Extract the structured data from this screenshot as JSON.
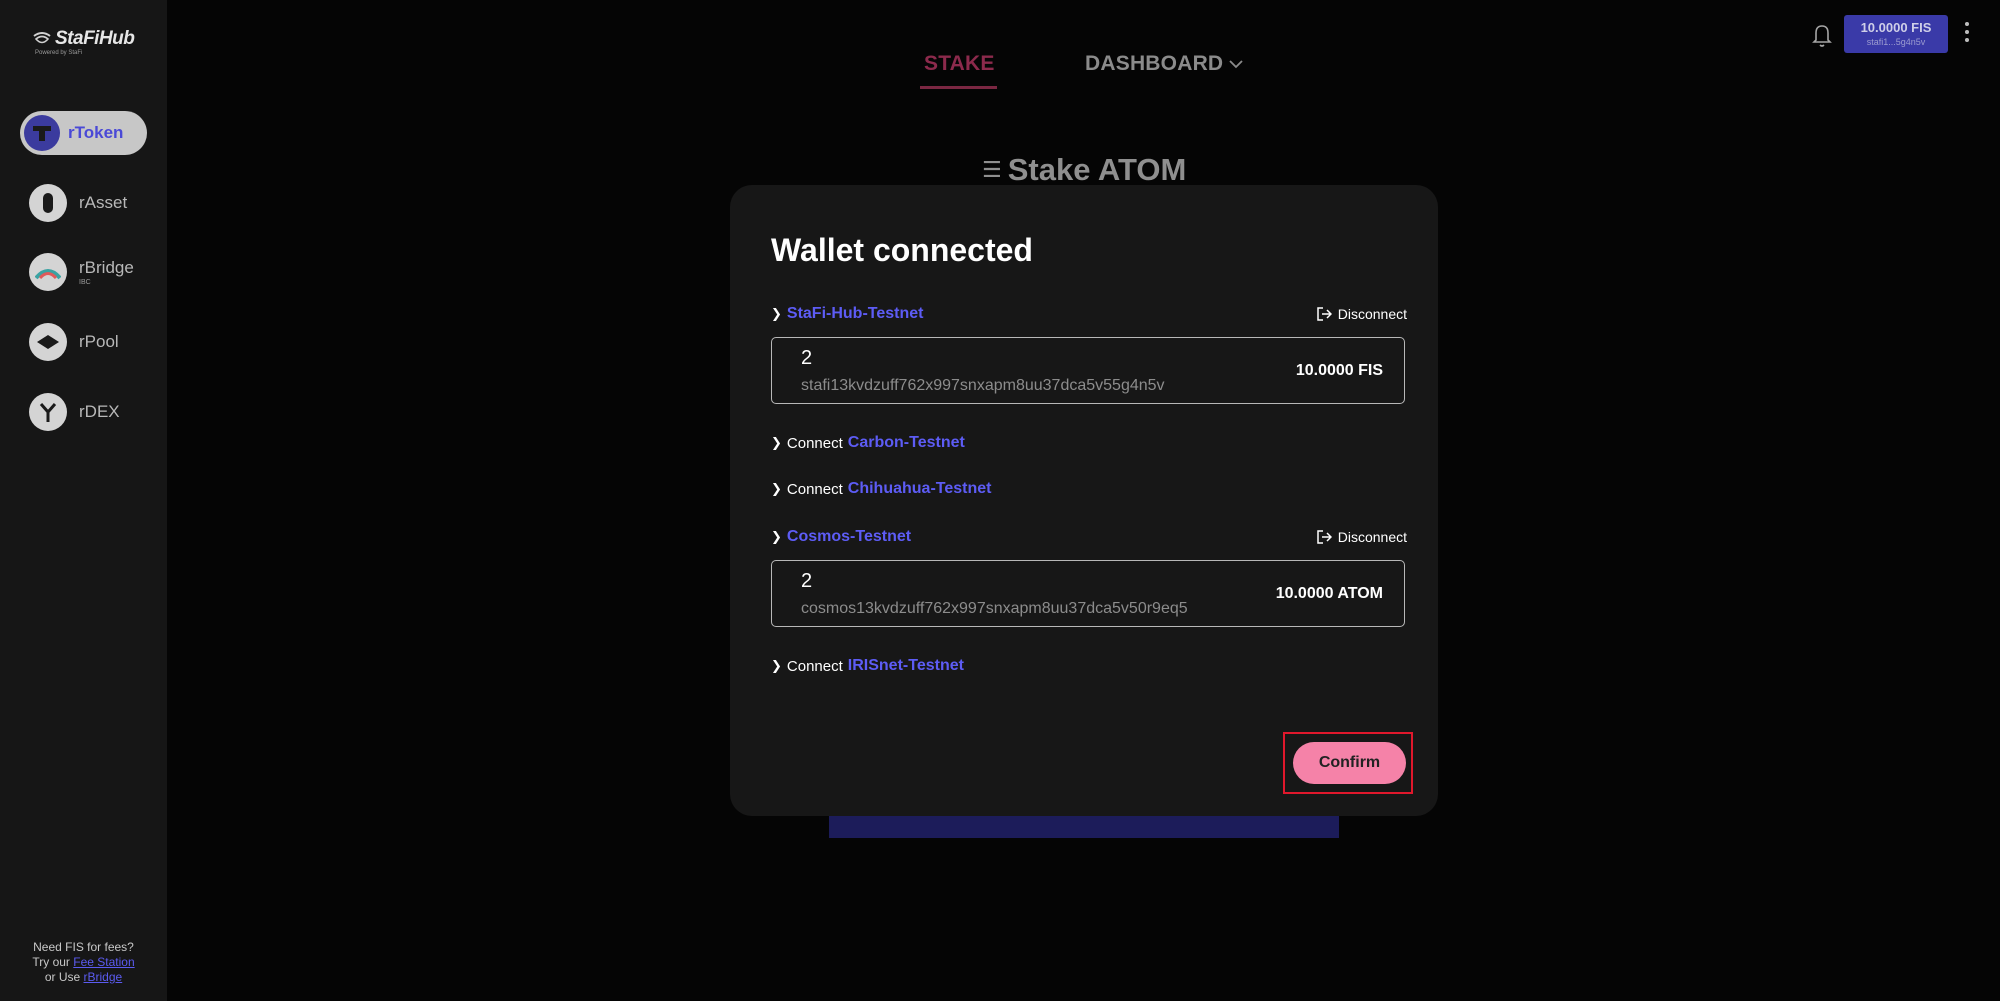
{
  "sidebar": {
    "logo_text": "StaFiHub",
    "logo_subtext": "Powered by StaFi",
    "items": [
      {
        "label": "rToken",
        "sub": ""
      },
      {
        "label": "rAsset",
        "sub": ""
      },
      {
        "label": "rBridge",
        "sub": "IBC"
      },
      {
        "label": "rPool",
        "sub": ""
      },
      {
        "label": "rDEX",
        "sub": ""
      }
    ],
    "fees": {
      "line1": "Need FIS for fees?",
      "line2_prefix": "Try our ",
      "fee_station_link": "Fee Station",
      "line3_prefix": "or Use ",
      "rbridge_link": "rBridge"
    }
  },
  "header": {
    "tabs": [
      {
        "label": "STAKE",
        "active": true
      },
      {
        "label": "DASHBOARD",
        "active": false
      }
    ],
    "balance": "10.0000 FIS",
    "address_short": "stafi1...5g4n5v"
  },
  "background": {
    "title": "Stake ATOM"
  },
  "modal": {
    "title": "Wallet connected",
    "connect_prefix": "Connect",
    "disconnect_label": "Disconnect",
    "chains": [
      {
        "name": "StaFi-Hub-Testnet",
        "connected": true,
        "account_name": "2",
        "address": "stafi13kvdzuff762x997snxapm8uu37dca5v55g4n5v",
        "balance": "10.0000 FIS"
      },
      {
        "name": "Carbon-Testnet",
        "connected": false
      },
      {
        "name": "Chihuahua-Testnet",
        "connected": false
      },
      {
        "name": "Cosmos-Testnet",
        "connected": true,
        "account_name": "2",
        "address": "cosmos13kvdzuff762x997snxapm8uu37dca5v50r9eq5",
        "balance": "10.0000 ATOM"
      },
      {
        "name": "IRISnet-Testnet",
        "connected": false
      }
    ],
    "confirm_label": "Confirm"
  },
  "colors": {
    "accent_blue": "#5d5cf5",
    "confirm_pink": "#f582a8",
    "stake_tab": "#8c2a4c",
    "modal_bg": "#171717"
  }
}
